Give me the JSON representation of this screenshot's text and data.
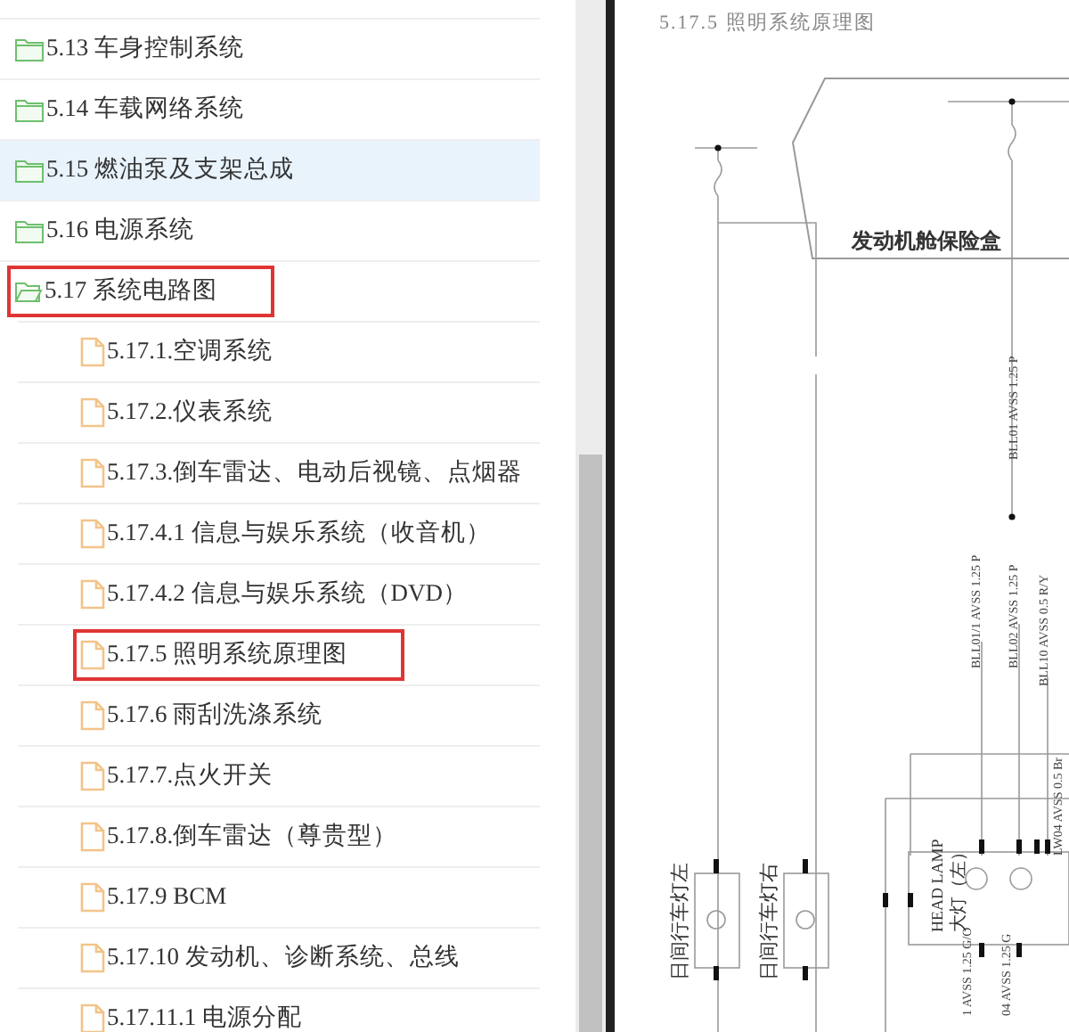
{
  "sidebar": {
    "items": [
      {
        "label": "5.13 车身控制系统",
        "kind": "folder",
        "expanded": false,
        "selected": false,
        "highlighted": false
      },
      {
        "label": "5.14 车载网络系统",
        "kind": "folder",
        "expanded": false,
        "selected": false,
        "highlighted": false
      },
      {
        "label": "5.15 燃油泵及支架总成",
        "kind": "folder",
        "expanded": false,
        "selected": true,
        "highlighted": false
      },
      {
        "label": "5.16 电源系统",
        "kind": "folder",
        "expanded": false,
        "selected": false,
        "highlighted": false
      },
      {
        "label": "5.17 系统电路图",
        "kind": "folder",
        "expanded": true,
        "selected": false,
        "highlighted": true,
        "children": [
          {
            "label": "5.17.1.空调系统",
            "kind": "file",
            "selected": false,
            "highlighted": false
          },
          {
            "label": "5.17.2.仪表系统",
            "kind": "file",
            "selected": false,
            "highlighted": false
          },
          {
            "label": "5.17.3.倒车雷达、电动后视镜、点烟器",
            "kind": "file",
            "selected": false,
            "highlighted": false
          },
          {
            "label": "5.17.4.1 信息与娱乐系统（收音机）",
            "kind": "file",
            "selected": false,
            "highlighted": false
          },
          {
            "label": "5.17.4.2 信息与娱乐系统（DVD）",
            "kind": "file",
            "selected": false,
            "highlighted": false
          },
          {
            "label": "5.17.5 照明系统原理图",
            "kind": "file",
            "selected": false,
            "highlighted": true
          },
          {
            "label": "5.17.6 雨刮洗涤系统",
            "kind": "file",
            "selected": false,
            "highlighted": false
          },
          {
            "label": "5.17.7.点火开关",
            "kind": "file",
            "selected": false,
            "highlighted": false
          },
          {
            "label": "5.17.8.倒车雷达（尊贵型）",
            "kind": "file",
            "selected": false,
            "highlighted": false
          },
          {
            "label": "5.17.9 BCM",
            "kind": "file",
            "selected": false,
            "highlighted": false
          },
          {
            "label": "5.17.10 发动机、诊断系统、总线",
            "kind": "file",
            "selected": false,
            "highlighted": false
          },
          {
            "label": "5.17.11.1 电源分配",
            "kind": "file",
            "selected": false,
            "highlighted": false
          }
        ]
      }
    ]
  },
  "document": {
    "title": "5.17.5 照明系统原理图",
    "fuse_box_label": "发动机舱保险盒",
    "wire_labels": [
      "BLL01 AVSS 1.25 P",
      "BLL01/1 AVSS 1.25 P",
      "BLL02 AVSS 1.25 P",
      "BLL10 AVSS 0.5 R/Y",
      "LW04 AVSS 0.5 Br",
      "1 AVSS 1.25 G/O",
      "04 AVSS 1.25 G"
    ],
    "lamp_labels": [
      "日间行车灯左",
      "日间行车灯右"
    ],
    "head_lamp_label": "HEAD LAMP",
    "head_lamp_label_cn": "大灯（左）"
  }
}
